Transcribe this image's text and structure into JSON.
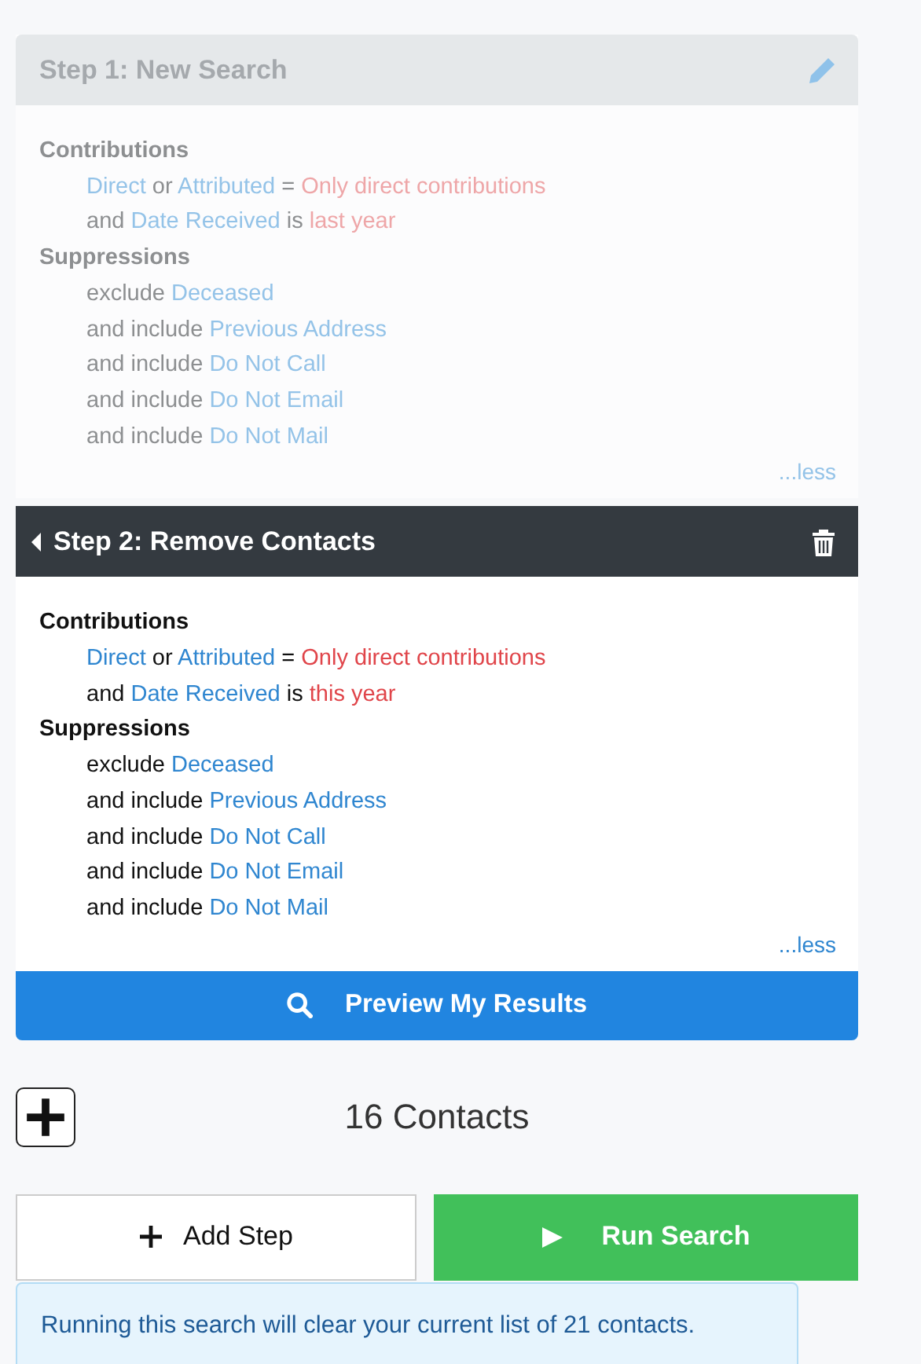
{
  "steps": [
    {
      "title": "Step 1: New Search",
      "active": false,
      "sections": [
        {
          "heading": "Contributions",
          "lines": [
            [
              {
                "kind": "field",
                "text": "Direct"
              },
              {
                "kind": "word",
                "text": "or"
              },
              {
                "kind": "field",
                "text": "Attributed"
              },
              {
                "kind": "word",
                "text": "="
              },
              {
                "kind": "value",
                "text": "Only direct contributions"
              }
            ],
            [
              {
                "kind": "word",
                "text": "and"
              },
              {
                "kind": "field",
                "text": "Date Received"
              },
              {
                "kind": "word",
                "text": "is"
              },
              {
                "kind": "value",
                "text": "last year"
              }
            ]
          ]
        },
        {
          "heading": "Suppressions",
          "lines": [
            [
              {
                "kind": "word",
                "text": "exclude"
              },
              {
                "kind": "field",
                "text": "Deceased"
              }
            ],
            [
              {
                "kind": "word",
                "text": "and include"
              },
              {
                "kind": "field",
                "text": "Previous Address"
              }
            ],
            [
              {
                "kind": "word",
                "text": "and include"
              },
              {
                "kind": "field",
                "text": "Do Not Call"
              }
            ],
            [
              {
                "kind": "word",
                "text": "and include"
              },
              {
                "kind": "field",
                "text": "Do Not Email"
              }
            ],
            [
              {
                "kind": "word",
                "text": "and include"
              },
              {
                "kind": "field",
                "text": "Do Not Mail"
              }
            ]
          ]
        }
      ],
      "toggle": "...less"
    },
    {
      "title": "Step 2: Remove Contacts",
      "active": true,
      "sections": [
        {
          "heading": "Contributions",
          "lines": [
            [
              {
                "kind": "field",
                "text": "Direct"
              },
              {
                "kind": "word",
                "text": "or"
              },
              {
                "kind": "field",
                "text": "Attributed"
              },
              {
                "kind": "word",
                "text": "="
              },
              {
                "kind": "value",
                "text": "Only direct contributions"
              }
            ],
            [
              {
                "kind": "word",
                "text": "and"
              },
              {
                "kind": "field",
                "text": "Date Received"
              },
              {
                "kind": "word",
                "text": "is"
              },
              {
                "kind": "value",
                "text": "this year"
              }
            ]
          ]
        },
        {
          "heading": "Suppressions",
          "lines": [
            [
              {
                "kind": "word",
                "text": "exclude"
              },
              {
                "kind": "field",
                "text": "Deceased"
              }
            ],
            [
              {
                "kind": "word",
                "text": "and include"
              },
              {
                "kind": "field",
                "text": "Previous Address"
              }
            ],
            [
              {
                "kind": "word",
                "text": "and include"
              },
              {
                "kind": "field",
                "text": "Do Not Call"
              }
            ],
            [
              {
                "kind": "word",
                "text": "and include"
              },
              {
                "kind": "field",
                "text": "Do Not Email"
              }
            ],
            [
              {
                "kind": "word",
                "text": "and include"
              },
              {
                "kind": "field",
                "text": "Do Not Mail"
              }
            ]
          ]
        }
      ],
      "toggle": "...less"
    }
  ],
  "preview_button": "Preview My Results",
  "result_count": "16 Contacts",
  "add_step_button": "Add Step",
  "run_search_button": "Run Search",
  "notice": "Running this search will clear your current list of 21 contacts."
}
